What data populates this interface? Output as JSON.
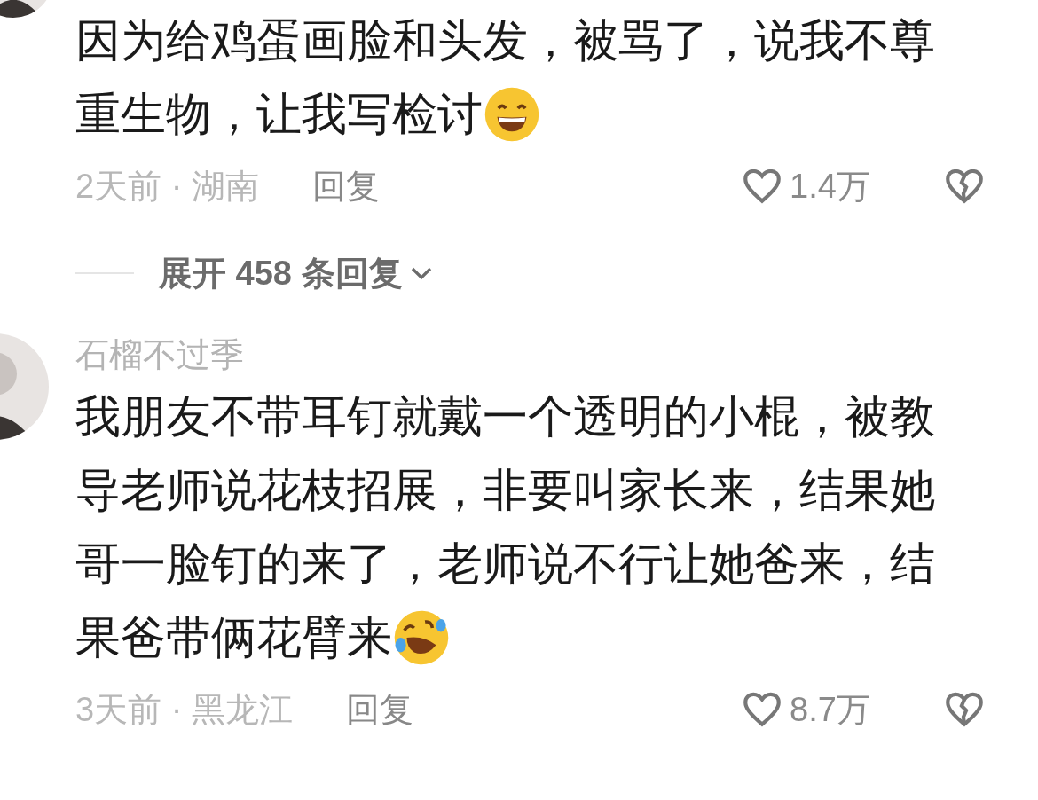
{
  "comments": [
    {
      "lines": [
        "因为给鸡蛋画脸和头发，被骂了，说我不尊",
        "重生物，让我写检讨"
      ],
      "time_location": "2天前 · 湖南",
      "reply": "回复",
      "likes": "1.4万",
      "expand_replies": "展开 458 条回复"
    },
    {
      "username": "石榴不过季",
      "lines": [
        "我朋友不带耳钉就戴一个透明的小棍，被教",
        "导老师说花枝招展，非要叫家长来，结果她",
        "哥一脸钉的来了，老师说不行让她爸来，结",
        "果爸带俩花臂来"
      ],
      "time_location": "3天前 · 黑龙江",
      "reply": "回复",
      "likes": "8.7万"
    }
  ]
}
